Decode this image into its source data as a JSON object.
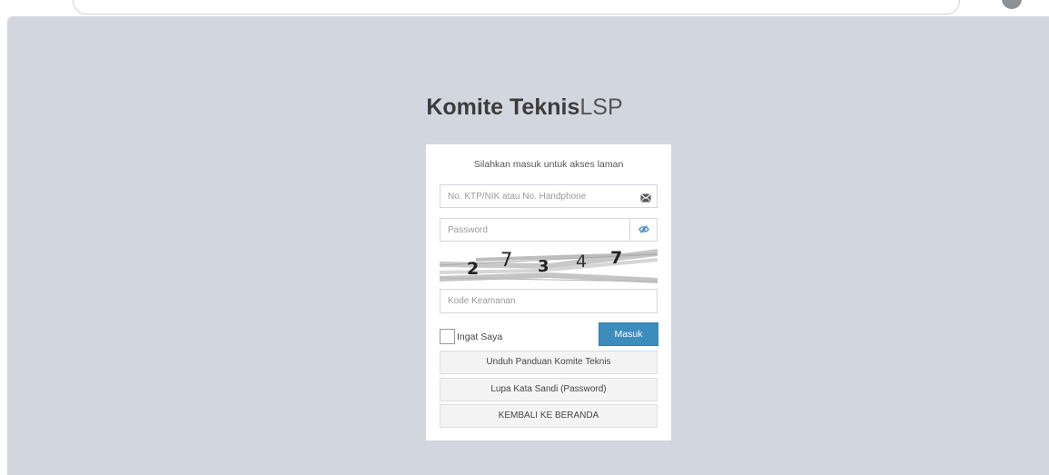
{
  "logo": {
    "bold": "Komite Teknis",
    "light": "LSP"
  },
  "login": {
    "message": "Silahkan masuk untuk akses laman",
    "ktp_placeholder": "No. KTP/NIK atau No. Handphone",
    "password_placeholder": "Password",
    "captcha_digits": [
      "2",
      "7",
      "3",
      "4",
      "7"
    ],
    "security_code_placeholder": "Kode Keamanan",
    "remember_label": "Ingat Saya",
    "submit_label": "Masuk",
    "download_guide_label": "Unduh Panduan Komite Teknis",
    "forgot_password_label": "Lupa Kata Sandi (Password)",
    "back_home_label": "KEMBALI KE BERANDA"
  },
  "colors": {
    "page_background": "#d2d6de",
    "primary_button": "#3c8dbc",
    "eye_icon": "#3c8dbc"
  },
  "icons": {
    "ktp_field": "envelope-icon",
    "password_field": "eye-slash-icon"
  }
}
